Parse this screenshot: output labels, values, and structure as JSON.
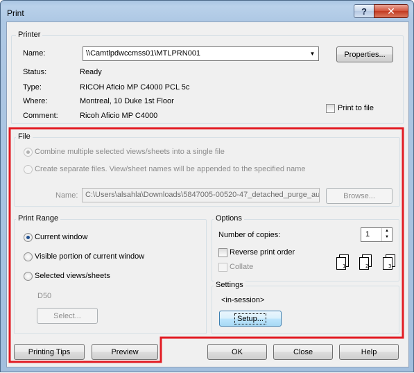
{
  "window": {
    "title": "Print",
    "help_glyph": "?",
    "close_glyph": "✕"
  },
  "printer": {
    "group_title": "Printer",
    "name_label": "Name:",
    "name_value": "\\\\Camtlpdwccmss01\\MTLPRN001",
    "properties_label": "Properties...",
    "status_label": "Status:",
    "status_value": "Ready",
    "type_label": "Type:",
    "type_value": "RICOH Aficio MP C4000 PCL 5c",
    "where_label": "Where:",
    "where_value": "Montreal, 10 Duke 1st Floor",
    "comment_label": "Comment:",
    "comment_value": "Ricoh Aficio MP C4000",
    "print_to_file_label": "Print to file"
  },
  "file": {
    "group_title": "File",
    "combine_label": "Combine multiple selected views/sheets into a single file",
    "separate_label": "Create separate files. View/sheet names will be appended to the specified name",
    "name_label": "Name:",
    "name_value": "C:\\Users\\alsahla\\Downloads\\5847005-00520-47_detached_purge_au",
    "browse_label": "Browse..."
  },
  "print_range": {
    "group_title": "Print Range",
    "current_window_label": "Current window",
    "visible_portion_label": "Visible portion of current window",
    "selected_views_label": "Selected views/sheets",
    "selection_name": "D50",
    "select_button_label": "Select..."
  },
  "options": {
    "group_title": "Options",
    "copies_label": "Number of copies:",
    "copies_value": "1",
    "reverse_order_label": "Reverse print order",
    "collate_label": "Collate"
  },
  "settings": {
    "group_title": "Settings",
    "current_setting": "<in-session>",
    "setup_label": "Setup..."
  },
  "footer": {
    "printing_tips_label": "Printing Tips",
    "preview_label": "Preview",
    "ok_label": "OK",
    "close_label": "Close",
    "help_label": "Help"
  },
  "colors": {
    "highlight_outline": "#e21b23",
    "title_gradient": "#a9c5e2",
    "close_button": "#c23b22"
  }
}
